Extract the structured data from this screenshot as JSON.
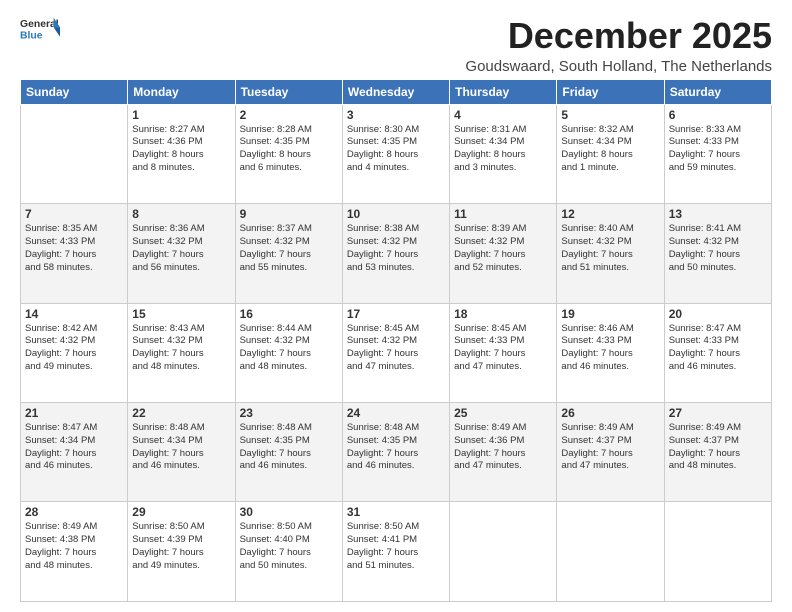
{
  "logo": {
    "general": "General",
    "blue": "Blue"
  },
  "title": "December 2025",
  "subtitle": "Goudswaard, South Holland, The Netherlands",
  "days_of_week": [
    "Sunday",
    "Monday",
    "Tuesday",
    "Wednesday",
    "Thursday",
    "Friday",
    "Saturday"
  ],
  "weeks": [
    [
      {
        "day": "",
        "info": ""
      },
      {
        "day": "1",
        "info": "Sunrise: 8:27 AM\nSunset: 4:36 PM\nDaylight: 8 hours\nand 8 minutes."
      },
      {
        "day": "2",
        "info": "Sunrise: 8:28 AM\nSunset: 4:35 PM\nDaylight: 8 hours\nand 6 minutes."
      },
      {
        "day": "3",
        "info": "Sunrise: 8:30 AM\nSunset: 4:35 PM\nDaylight: 8 hours\nand 4 minutes."
      },
      {
        "day": "4",
        "info": "Sunrise: 8:31 AM\nSunset: 4:34 PM\nDaylight: 8 hours\nand 3 minutes."
      },
      {
        "day": "5",
        "info": "Sunrise: 8:32 AM\nSunset: 4:34 PM\nDaylight: 8 hours\nand 1 minute."
      },
      {
        "day": "6",
        "info": "Sunrise: 8:33 AM\nSunset: 4:33 PM\nDaylight: 7 hours\nand 59 minutes."
      }
    ],
    [
      {
        "day": "7",
        "info": "Sunrise: 8:35 AM\nSunset: 4:33 PM\nDaylight: 7 hours\nand 58 minutes."
      },
      {
        "day": "8",
        "info": "Sunrise: 8:36 AM\nSunset: 4:32 PM\nDaylight: 7 hours\nand 56 minutes."
      },
      {
        "day": "9",
        "info": "Sunrise: 8:37 AM\nSunset: 4:32 PM\nDaylight: 7 hours\nand 55 minutes."
      },
      {
        "day": "10",
        "info": "Sunrise: 8:38 AM\nSunset: 4:32 PM\nDaylight: 7 hours\nand 53 minutes."
      },
      {
        "day": "11",
        "info": "Sunrise: 8:39 AM\nSunset: 4:32 PM\nDaylight: 7 hours\nand 52 minutes."
      },
      {
        "day": "12",
        "info": "Sunrise: 8:40 AM\nSunset: 4:32 PM\nDaylight: 7 hours\nand 51 minutes."
      },
      {
        "day": "13",
        "info": "Sunrise: 8:41 AM\nSunset: 4:32 PM\nDaylight: 7 hours\nand 50 minutes."
      }
    ],
    [
      {
        "day": "14",
        "info": "Sunrise: 8:42 AM\nSunset: 4:32 PM\nDaylight: 7 hours\nand 49 minutes."
      },
      {
        "day": "15",
        "info": "Sunrise: 8:43 AM\nSunset: 4:32 PM\nDaylight: 7 hours\nand 48 minutes."
      },
      {
        "day": "16",
        "info": "Sunrise: 8:44 AM\nSunset: 4:32 PM\nDaylight: 7 hours\nand 48 minutes."
      },
      {
        "day": "17",
        "info": "Sunrise: 8:45 AM\nSunset: 4:32 PM\nDaylight: 7 hours\nand 47 minutes."
      },
      {
        "day": "18",
        "info": "Sunrise: 8:45 AM\nSunset: 4:33 PM\nDaylight: 7 hours\nand 47 minutes."
      },
      {
        "day": "19",
        "info": "Sunrise: 8:46 AM\nSunset: 4:33 PM\nDaylight: 7 hours\nand 46 minutes."
      },
      {
        "day": "20",
        "info": "Sunrise: 8:47 AM\nSunset: 4:33 PM\nDaylight: 7 hours\nand 46 minutes."
      }
    ],
    [
      {
        "day": "21",
        "info": "Sunrise: 8:47 AM\nSunset: 4:34 PM\nDaylight: 7 hours\nand 46 minutes."
      },
      {
        "day": "22",
        "info": "Sunrise: 8:48 AM\nSunset: 4:34 PM\nDaylight: 7 hours\nand 46 minutes."
      },
      {
        "day": "23",
        "info": "Sunrise: 8:48 AM\nSunset: 4:35 PM\nDaylight: 7 hours\nand 46 minutes."
      },
      {
        "day": "24",
        "info": "Sunrise: 8:48 AM\nSunset: 4:35 PM\nDaylight: 7 hours\nand 46 minutes."
      },
      {
        "day": "25",
        "info": "Sunrise: 8:49 AM\nSunset: 4:36 PM\nDaylight: 7 hours\nand 47 minutes."
      },
      {
        "day": "26",
        "info": "Sunrise: 8:49 AM\nSunset: 4:37 PM\nDaylight: 7 hours\nand 47 minutes."
      },
      {
        "day": "27",
        "info": "Sunrise: 8:49 AM\nSunset: 4:37 PM\nDaylight: 7 hours\nand 48 minutes."
      }
    ],
    [
      {
        "day": "28",
        "info": "Sunrise: 8:49 AM\nSunset: 4:38 PM\nDaylight: 7 hours\nand 48 minutes."
      },
      {
        "day": "29",
        "info": "Sunrise: 8:50 AM\nSunset: 4:39 PM\nDaylight: 7 hours\nand 49 minutes."
      },
      {
        "day": "30",
        "info": "Sunrise: 8:50 AM\nSunset: 4:40 PM\nDaylight: 7 hours\nand 50 minutes."
      },
      {
        "day": "31",
        "info": "Sunrise: 8:50 AM\nSunset: 4:41 PM\nDaylight: 7 hours\nand 51 minutes."
      },
      {
        "day": "",
        "info": ""
      },
      {
        "day": "",
        "info": ""
      },
      {
        "day": "",
        "info": ""
      }
    ]
  ]
}
